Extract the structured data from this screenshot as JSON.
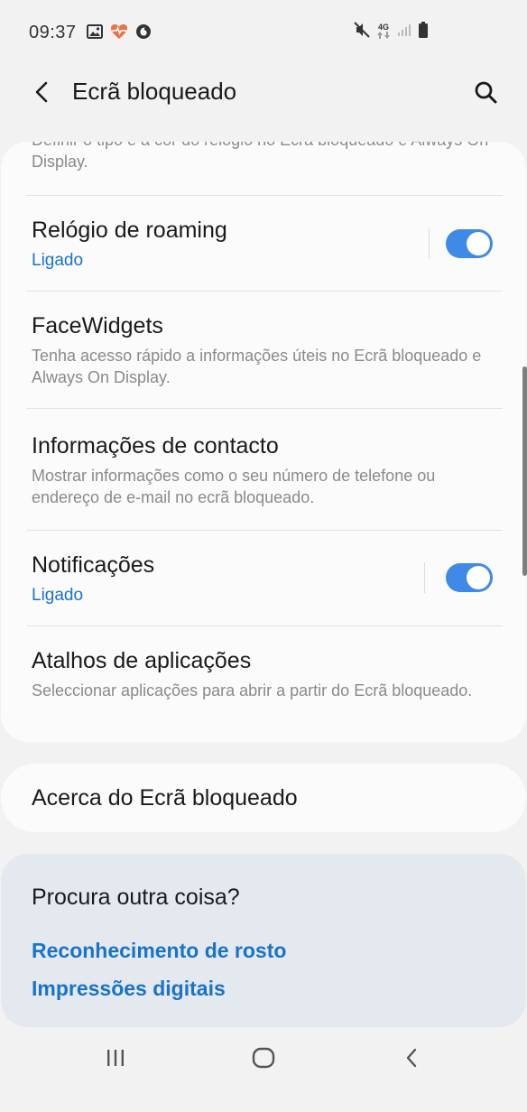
{
  "status_bar": {
    "time": "09:37",
    "left_icons": [
      "image-icon",
      "heart-rate-icon",
      "vodafone-icon"
    ],
    "right_icons": [
      "mute-icon",
      "4g-icon",
      "signal-icon",
      "battery-icon"
    ],
    "network_label": "4G"
  },
  "app_bar": {
    "title": "Ecrã bloqueado",
    "back_icon": "back-arrow-icon",
    "search_icon": "search-icon"
  },
  "settings": {
    "top_partial_sub": "Definir o tipo e a cor do relógio no Ecrã bloqueado e Always On Display.",
    "roaming_clock": {
      "title": "Relógio de roaming",
      "status": "Ligado",
      "enabled": true
    },
    "facewidgets": {
      "title": "FaceWidgets",
      "sub": "Tenha acesso rápido a informações úteis no Ecrã bloqueado e Always On Display."
    },
    "contact_info": {
      "title": "Informações de contacto",
      "sub": "Mostrar informações como o seu número de telefone ou endereço de e-mail no ecrã bloqueado."
    },
    "notifications": {
      "title": "Notificações",
      "status": "Ligado",
      "enabled": true
    },
    "app_shortcuts": {
      "title": "Atalhos de aplicações",
      "sub": "Seleccionar aplicações para abrir a partir do Ecrã bloqueado."
    }
  },
  "about": {
    "label": "Acerca do Ecrã bloqueado"
  },
  "suggestions": {
    "title": "Procura outra coisa?",
    "links": [
      "Reconhecimento de rosto",
      "Impressões digitais"
    ]
  },
  "nav_bar": {
    "buttons": [
      "recents-icon",
      "home-icon",
      "back-icon"
    ]
  },
  "colors": {
    "accent": "#1a73c8",
    "toggle_on": "#3e8ae6",
    "background": "#f2f2f2",
    "card": "#fbfbfb",
    "suggestion_card": "#e3e9ef"
  }
}
